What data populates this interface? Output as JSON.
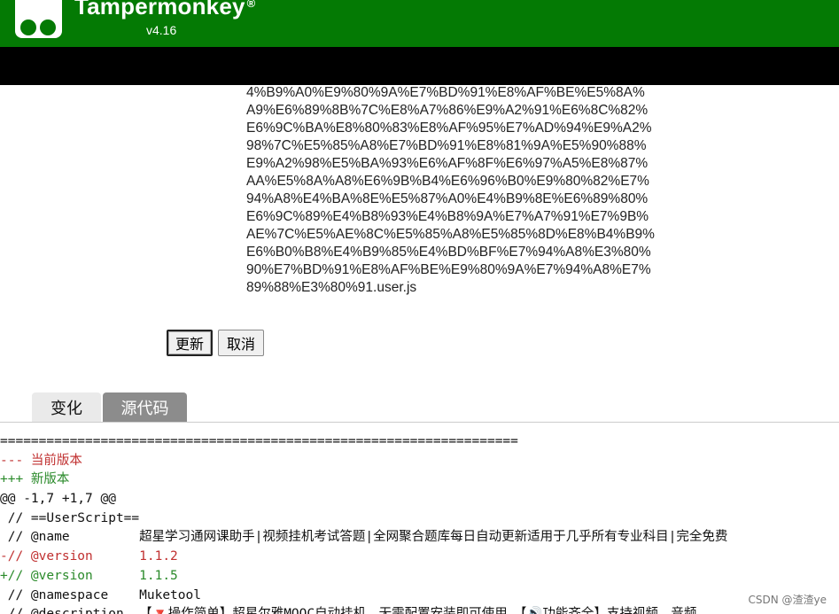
{
  "header": {
    "brand": "Tampermonkey",
    "trademark": "®",
    "version": "v4.16"
  },
  "filename_lines": [
    "4%B9%A0%E9%80%9A%E7%BD%91%E8%AF%BE%E5%8A%",
    "A9%E6%89%8B%7C%E8%A7%86%E9%A2%91%E6%8C%82%",
    "E6%9C%BA%E8%80%83%E8%AF%95%E7%AD%94%E9%A2%",
    "98%7C%E5%85%A8%E7%BD%91%E8%81%9A%E5%90%88%",
    "E9%A2%98%E5%BA%93%E6%AF%8F%E6%97%A5%E8%87%",
    "AA%E5%8A%A8%E6%9B%B4%E6%96%B0%E9%80%82%E7%",
    "94%A8%E4%BA%8E%E5%87%A0%E4%B9%8E%E6%89%80%",
    "E6%9C%89%E4%B8%93%E4%B8%9A%E7%A7%91%E7%9B%",
    "AE%7C%E5%AE%8C%E5%85%A8%E5%85%8D%E8%B4%B9%",
    "E6%B0%B8%E4%B9%85%E4%BD%BF%E7%94%A8%E3%80%",
    "90%E7%BD%91%E8%AF%BE%E9%80%9A%E7%94%A8%E7%",
    "89%88%E3%80%91.user.js"
  ],
  "buttons": {
    "update": "更新",
    "cancel": "取消"
  },
  "tabs": {
    "changes": "变化",
    "source": "源代码"
  },
  "diff": {
    "separator": "===================================================================",
    "old_header": "--- 当前版本",
    "new_header": "+++ 新版本",
    "hunk": "@@ -1,7 +1,7 @@",
    "lines": [
      {
        "type": "ctx",
        "text": " // ==UserScript=="
      },
      {
        "type": "ctx",
        "text": " // @name         超星学习通网课助手|视频挂机考试答题|全网聚合题库每日自动更新适用于几乎所有专业科目|完全免费"
      },
      {
        "type": "del",
        "text": "-// @version      1.1.2"
      },
      {
        "type": "add",
        "text": "+// @version      1.1.5"
      },
      {
        "type": "ctx",
        "text": " // @namespace    Muketool"
      },
      {
        "type": "ctx",
        "text": " // @description  【🔻操作简单】超星尔雅MOOC自动挂机，无需配置安装即可使用，【🔊功能齐全】支持视频、音频"
      }
    ]
  },
  "watermark": "CSDN @渣渣ye"
}
